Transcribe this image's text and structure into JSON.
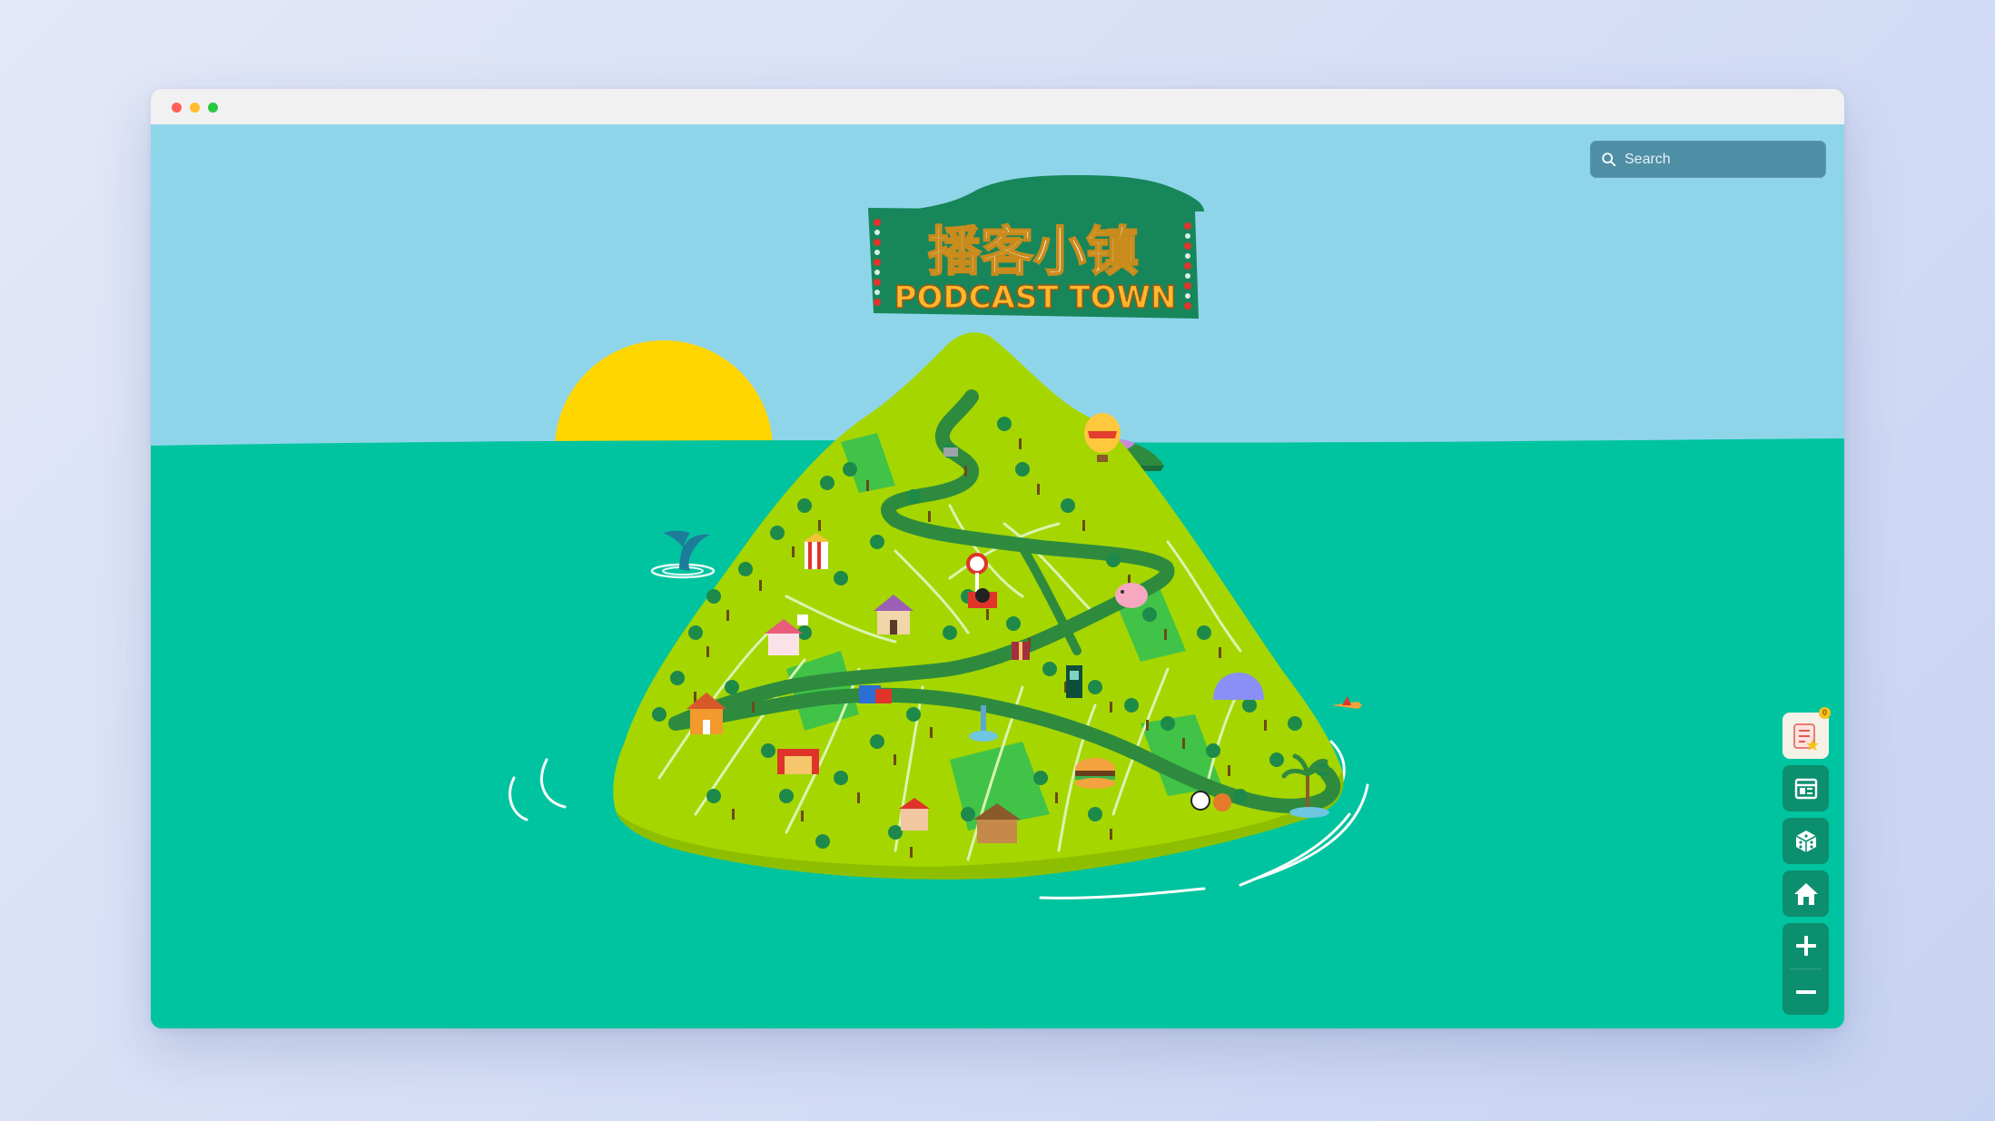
{
  "window": {
    "controls": [
      "close",
      "minimize",
      "maximize"
    ]
  },
  "logo": {
    "title_cn": "播客小镇",
    "title_en": "PODCAST TOWN"
  },
  "search": {
    "placeholder": "Search",
    "value": ""
  },
  "sidebar": {
    "favorites_badge": "0",
    "buttons": [
      "favorites-button",
      "news-button",
      "random-dice-button",
      "home-button"
    ],
    "zoom": [
      "zoom-in-button",
      "zoom-out-button"
    ]
  },
  "icons": [
    "search-icon",
    "favorites-icon",
    "news-icon",
    "dice-icon",
    "home-icon",
    "plus-icon",
    "minus-icon"
  ],
  "colors": {
    "sky": "#8fd5ea",
    "sea": "#00c49f",
    "sun": "#ffd600",
    "island": "#a6d600",
    "road": "#3fa85b",
    "banner": "#17865a",
    "logo_text_cn": "#ffffff",
    "logo_text_en": "#ffb82e",
    "control_button": "#0c8f6f",
    "search_bg": "#4f8fa6"
  }
}
